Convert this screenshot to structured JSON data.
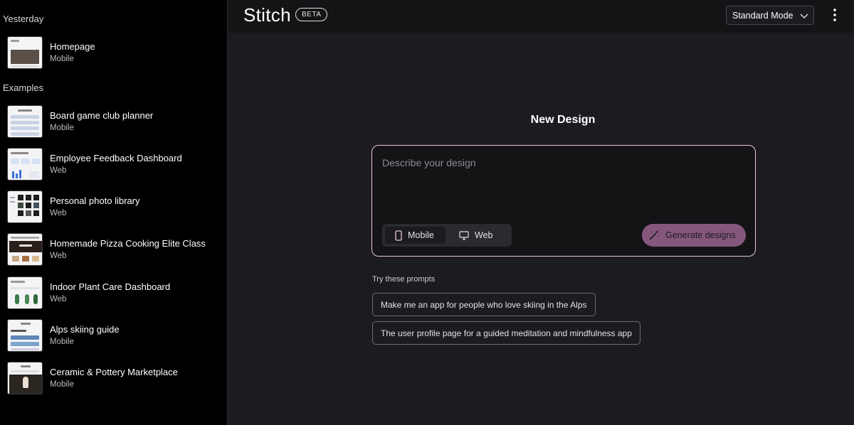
{
  "sidebar": {
    "sections": [
      {
        "label": "Yesterday",
        "items": [
          {
            "title": "Homepage",
            "sub": "Mobile"
          }
        ]
      },
      {
        "label": "Examples",
        "items": [
          {
            "title": "Board game club planner",
            "sub": "Mobile"
          },
          {
            "title": "Employee Feedback Dashboard",
            "sub": "Web"
          },
          {
            "title": "Personal photo library",
            "sub": "Web"
          },
          {
            "title": "Homemade Pizza Cooking Elite Class",
            "sub": "Web"
          },
          {
            "title": "Indoor Plant Care Dashboard",
            "sub": "Web"
          },
          {
            "title": "Alps skiing guide",
            "sub": "Mobile"
          },
          {
            "title": "Ceramic & Pottery Marketplace",
            "sub": "Mobile"
          }
        ]
      }
    ]
  },
  "header": {
    "logo": "Stitch",
    "badge": "BETA",
    "mode": "Standard Mode",
    "more_icon": "more-vertical-icon"
  },
  "main": {
    "title": "New Design",
    "prompt_placeholder": "Describe your design",
    "platform_toggle": [
      {
        "label": "Mobile",
        "icon": "phone-icon",
        "active": true
      },
      {
        "label": "Web",
        "icon": "monitor-icon",
        "active": false
      }
    ],
    "generate_label": "Generate designs",
    "generate_icon": "magic-wand-icon",
    "try_label": "Try these prompts",
    "suggestions": [
      "Make me an app for people who love skiing in the Alps",
      "The user profile page for a guided meditation and mindfulness app"
    ]
  },
  "colors": {
    "accent": "#86577d",
    "prompt_border": "#e7c8de",
    "background": "#1c1b1f",
    "sidebar": "#000000"
  }
}
